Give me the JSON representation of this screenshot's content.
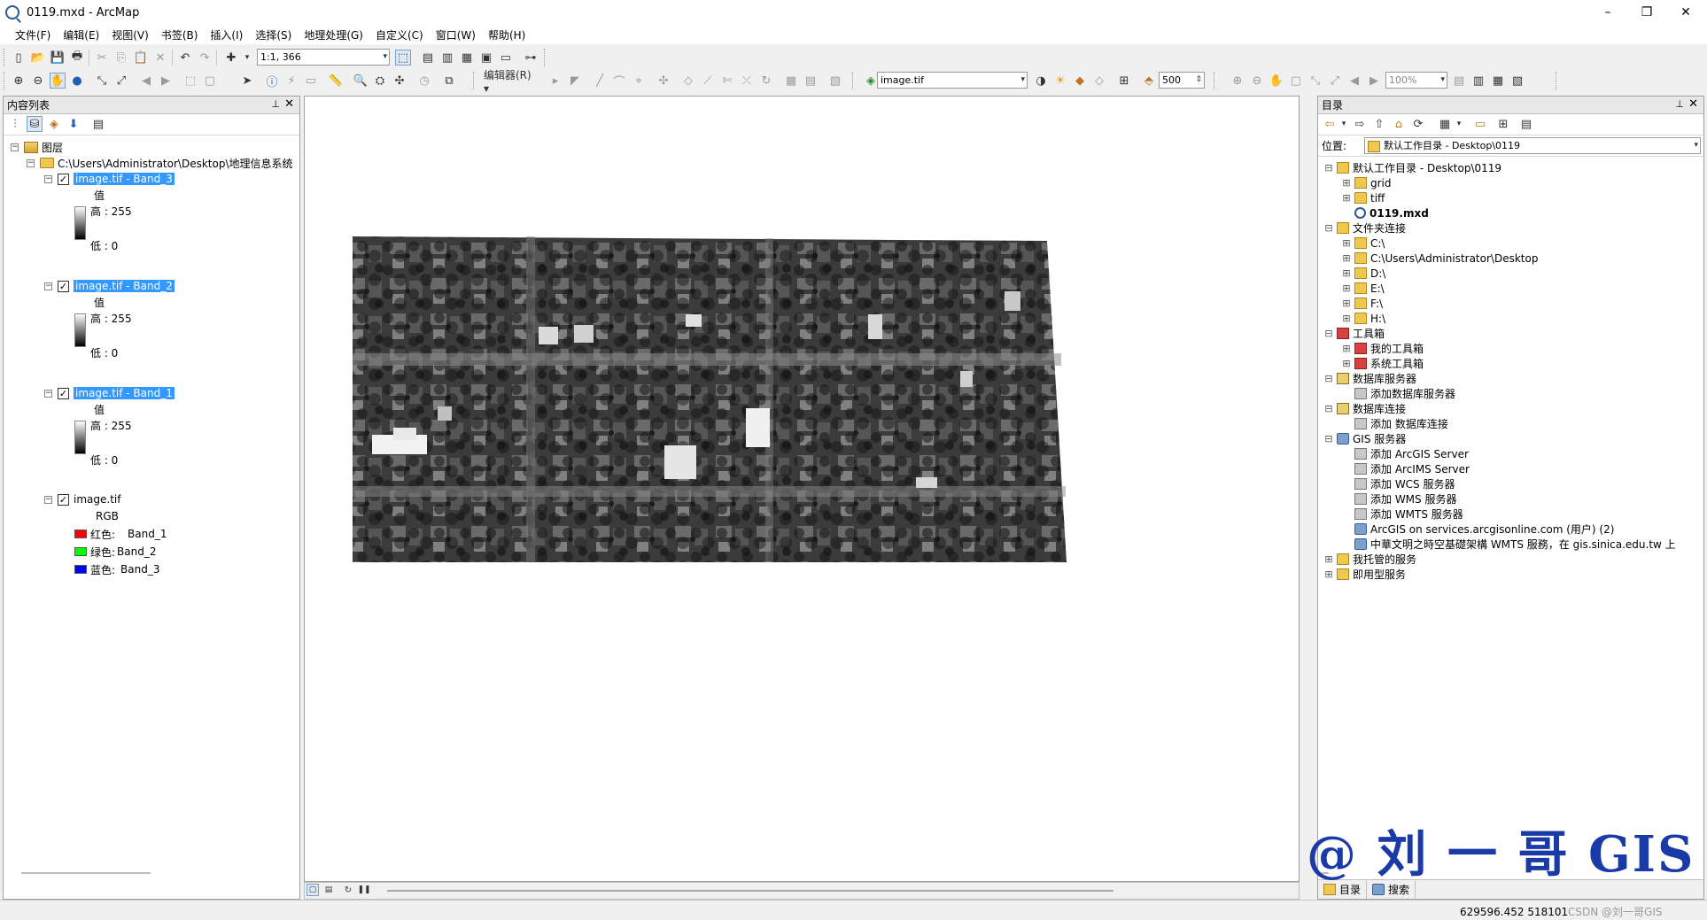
{
  "window": {
    "title": "0119.mxd - ArcMap",
    "minimize": "–",
    "maximize": "❐",
    "close": "✕"
  },
  "menu": [
    "文件(F)",
    "编辑(E)",
    "视图(V)",
    "书签(B)",
    "插入(I)",
    "选择(S)",
    "地理处理(G)",
    "自定义(C)",
    "窗口(W)",
    "帮助(H)"
  ],
  "toolbar": {
    "scale": "1:1, 366",
    "editor_label": "编辑器(R) ▾",
    "layer_combo": "image.tif",
    "value_500": "500",
    "zoom_pct": "100%"
  },
  "toc": {
    "title": "内容列表",
    "pin": "⊥",
    "close": "✕",
    "root": "图层",
    "path": "C:\\Users\\Administrator\\Desktop\\地理信息系统",
    "layers": [
      {
        "name": "image.tif - Band_3",
        "value_label": "值",
        "high": "高 : 255",
        "low": "低 : 0"
      },
      {
        "name": "image.tif - Band_2",
        "value_label": "值",
        "high": "高 : 255",
        "low": "低 : 0"
      },
      {
        "name": "image.tif - Band_1",
        "value_label": "值",
        "high": "高 : 255",
        "low": "低 : 0"
      }
    ],
    "rgb_layer": {
      "name": "image.tif",
      "rgb": "RGB",
      "red": "红色:",
      "red_band": "Band_1",
      "green": "绿色:",
      "green_band": "Band_2",
      "blue": "蓝色:",
      "blue_band": "Band_3"
    }
  },
  "catalog": {
    "title": "目录",
    "pin": "⊥",
    "close": "✕",
    "location_label": "位置:",
    "location_value": "默认工作目录 - Desktop\\0119",
    "items": [
      {
        "label": "默认工作目录 - Desktop\\0119",
        "indent": 0,
        "pm": "⊟",
        "icon": "fold"
      },
      {
        "label": "grid",
        "indent": 1,
        "pm": "⊞",
        "icon": "fold"
      },
      {
        "label": "tiff",
        "indent": 1,
        "pm": "⊞",
        "icon": "fold"
      },
      {
        "label": "0119.mxd",
        "indent": 1,
        "pm": "",
        "icon": "mxd",
        "bold": true
      },
      {
        "label": "文件夹连接",
        "indent": 0,
        "pm": "⊟",
        "icon": "fold"
      },
      {
        "label": "C:\\",
        "indent": 1,
        "pm": "⊞",
        "icon": "fold"
      },
      {
        "label": "C:\\Users\\Administrator\\Desktop",
        "indent": 1,
        "pm": "⊞",
        "icon": "fold"
      },
      {
        "label": "D:\\",
        "indent": 1,
        "pm": "⊞",
        "icon": "fold"
      },
      {
        "label": "E:\\",
        "indent": 1,
        "pm": "⊞",
        "icon": "fold"
      },
      {
        "label": "F:\\",
        "indent": 1,
        "pm": "⊞",
        "icon": "fold"
      },
      {
        "label": "H:\\",
        "indent": 1,
        "pm": "⊞",
        "icon": "fold"
      },
      {
        "label": "工具箱",
        "indent": 0,
        "pm": "⊟",
        "icon": "tbx"
      },
      {
        "label": "我的工具箱",
        "indent": 1,
        "pm": "⊞",
        "icon": "tbx"
      },
      {
        "label": "系统工具箱",
        "indent": 1,
        "pm": "⊞",
        "icon": "tbx"
      },
      {
        "label": "数据库服务器",
        "indent": 0,
        "pm": "⊟",
        "icon": "db"
      },
      {
        "label": "添加数据库服务器",
        "indent": 1,
        "pm": "",
        "icon": "add"
      },
      {
        "label": "数据库连接",
        "indent": 0,
        "pm": "⊟",
        "icon": "db"
      },
      {
        "label": "添加 数据库连接",
        "indent": 1,
        "pm": "",
        "icon": "add"
      },
      {
        "label": "GIS 服务器",
        "indent": 0,
        "pm": "⊟",
        "icon": "srv"
      },
      {
        "label": "添加 ArcGIS Server",
        "indent": 1,
        "pm": "",
        "icon": "add"
      },
      {
        "label": "添加 ArcIMS Server",
        "indent": 1,
        "pm": "",
        "icon": "add"
      },
      {
        "label": "添加 WCS 服务器",
        "indent": 1,
        "pm": "",
        "icon": "add"
      },
      {
        "label": "添加 WMS 服务器",
        "indent": 1,
        "pm": "",
        "icon": "add"
      },
      {
        "label": "添加 WMTS 服务器",
        "indent": 1,
        "pm": "",
        "icon": "add"
      },
      {
        "label": "ArcGIS on services.arcgisonline.com (用户) (2)",
        "indent": 1,
        "pm": "",
        "icon": "srv"
      },
      {
        "label": "中華文明之時空基礎架構 WMTS 服務，在 gis.sinica.edu.tw 上",
        "indent": 1,
        "pm": "",
        "icon": "srv"
      },
      {
        "label": "我托管的服务",
        "indent": 0,
        "pm": "⊞",
        "icon": "fold"
      },
      {
        "label": "即用型服务",
        "indent": 0,
        "pm": "⊞",
        "icon": "fold"
      }
    ],
    "tab_catalog": "目录",
    "tab_search": "搜索"
  },
  "status": {
    "coords": "629596.452  5181011.611 米",
    "credit": "CSDN @刘一哥GIS"
  },
  "watermark": "@ 刘 一 哥 GIS"
}
